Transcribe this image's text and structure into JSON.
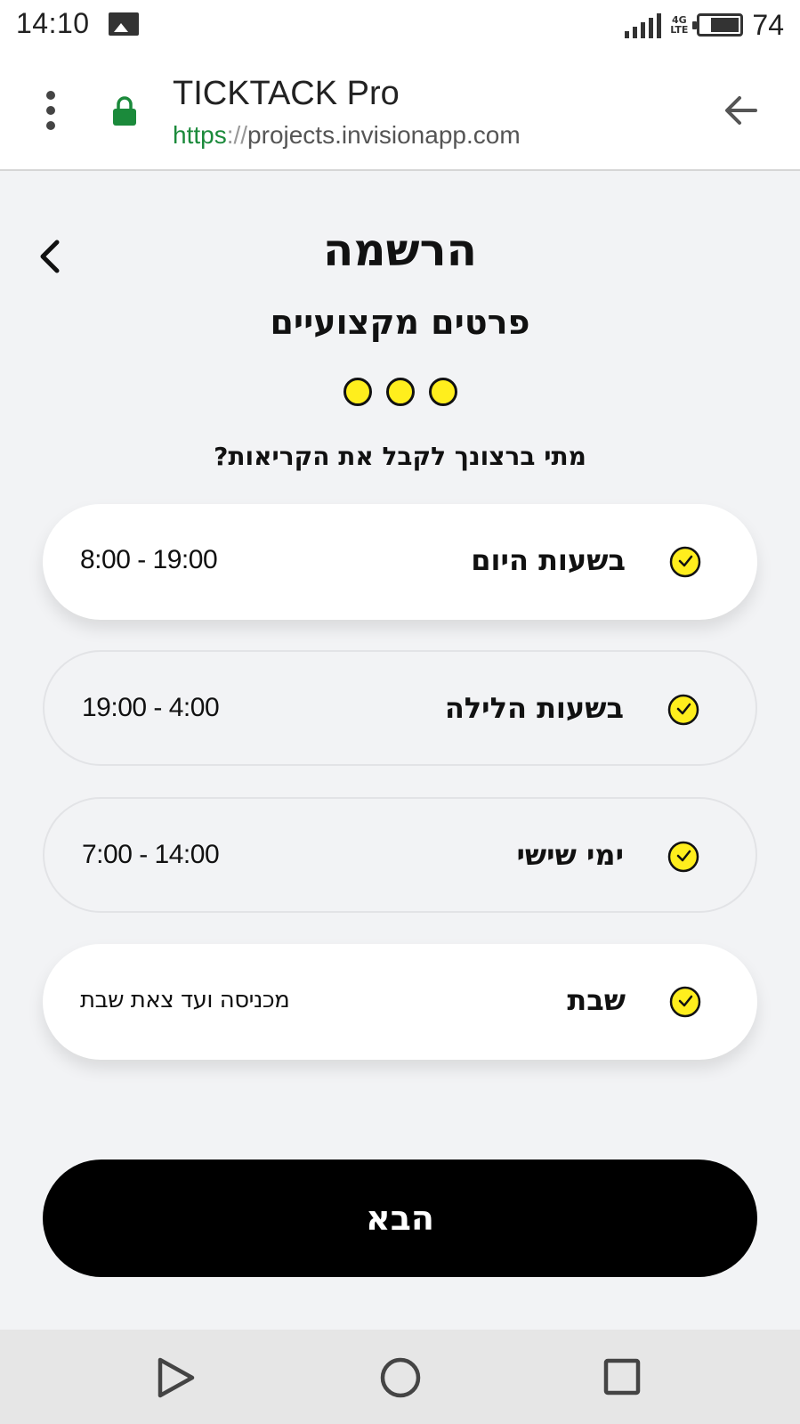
{
  "status_bar": {
    "time": "14:10",
    "network": "4G",
    "network_sub": "LTE",
    "battery": "74",
    "battery_level": 0.74
  },
  "browser": {
    "title": "TICKTACK Pro",
    "url_scheme": "https",
    "url_separator": "://",
    "url_host": "projects.invisionapp.com"
  },
  "screen": {
    "title": "הרשמה",
    "subtitle": "פרטים מקצועיים",
    "question": "מתי ברצונך לקבל את הקריאות?",
    "progress_steps": 3
  },
  "options": [
    {
      "label": "בשעות היום",
      "hours": "8:00 - 19:00",
      "selected": true
    },
    {
      "label": "בשעות הלילה",
      "hours": "19:00 - 4:00",
      "selected": false
    },
    {
      "label": "ימי שישי",
      "hours": "7:00 - 14:00",
      "selected": false
    },
    {
      "label": "שבת",
      "hours": "מכניסה ועד צאת שבת",
      "selected": true
    }
  ],
  "next_button": {
    "label": "הבא"
  },
  "colors": {
    "accent": "#ffee1d",
    "button": "#000000",
    "secure": "#1b8a3b",
    "background": "#f2f3f5"
  },
  "icons": {
    "menu": "more-vert-icon",
    "lock": "lock-icon",
    "back": "arrow-back-icon",
    "chevron": "chevron-left-icon",
    "option": "clock-icon"
  }
}
